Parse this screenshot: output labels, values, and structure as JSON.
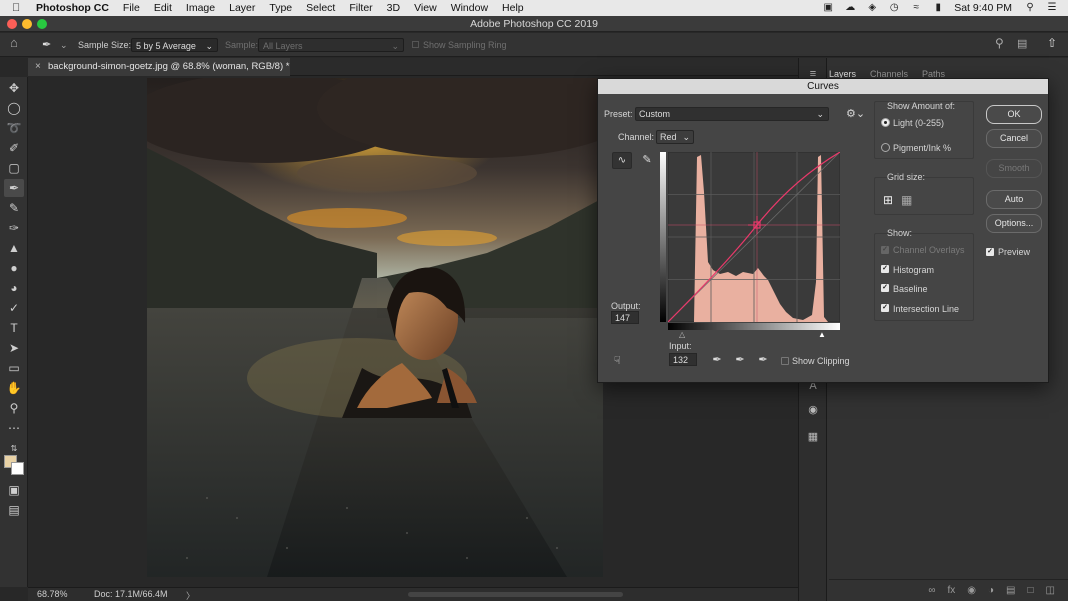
{
  "menubar": {
    "app_name": "Photoshop CC",
    "items": [
      "File",
      "Edit",
      "Image",
      "Layer",
      "Type",
      "Select",
      "Filter",
      "3D",
      "View",
      "Window",
      "Help"
    ],
    "clock": "Sat 9:40 PM"
  },
  "window": {
    "title": "Adobe Photoshop CC 2019",
    "traffic_lights": [
      "#fc5f57",
      "#fdbc2e",
      "#28c840"
    ]
  },
  "options_bar": {
    "sample_size_label": "Sample Size:",
    "sample_size_value": "5 by 5 Average",
    "sample_label": "Sample:",
    "sample_value": "All Layers",
    "show_sampling_ring": "Show Sampling Ring"
  },
  "document": {
    "tab_title": "background-simon-goetz.jpg @ 68.8% (woman, RGB/8) *"
  },
  "status": {
    "zoom": "68.78%",
    "doc_size": "Doc: 17.1M/66.4M",
    "arrow": "〉"
  },
  "panels": {
    "tabs": [
      "Layers",
      "Channels",
      "Paths"
    ],
    "active_tab": "Layers"
  },
  "curves": {
    "title": "Curves",
    "preset_label": "Preset:",
    "preset_value": "Custom",
    "channel_label": "Channel:",
    "channel_value": "Red",
    "output_label": "Output:",
    "output_value": "147",
    "input_label": "Input:",
    "input_value": "132",
    "show_clipping": "Show Clipping",
    "show_amount_label": "Show Amount of:",
    "light_option": "Light  (0-255)",
    "pigment_option": "Pigment/Ink %",
    "grid_size_label": "Grid size:",
    "show_label": "Show:",
    "channel_overlays": "Channel Overlays",
    "histogram": "Histogram",
    "baseline": "Baseline",
    "intersection_line": "Intersection Line",
    "preview": "Preview",
    "buttons": {
      "ok": "OK",
      "cancel": "Cancel",
      "smooth": "Smooth",
      "auto": "Auto",
      "options": "Options..."
    },
    "histogram_color": "#f2b6a5",
    "point_color": "#e8396a"
  }
}
